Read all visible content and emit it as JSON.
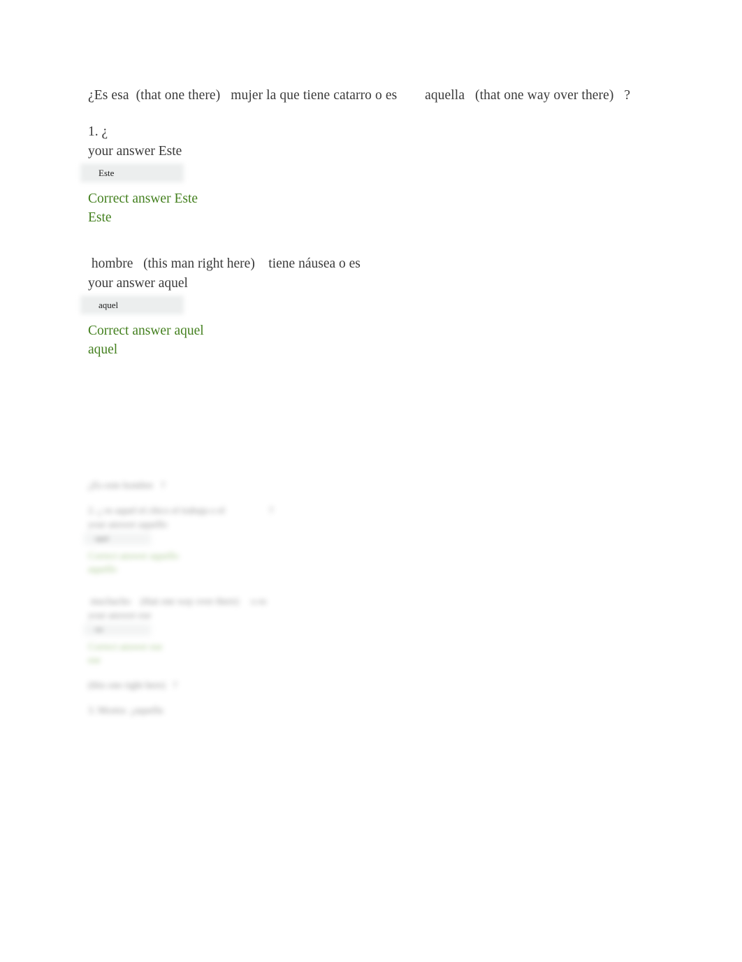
{
  "document": {
    "type": "quiz-answer-review",
    "background_color": "#ffffff",
    "body_text_color": "#3a3a3a",
    "correct_answer_color": "#44801f",
    "answer_box_fill": "#eceeee"
  },
  "upper_section": {
    "header_prompt": "¿Es esa  (that one there)   mujer la que tiene catarro o es        aquella   (that one way over there)   ?",
    "items": [
      {
        "number_prompt": "1. ¿",
        "your_answer_label": "your answer Este",
        "answer_box_value": "Este",
        "correct_answer_label": "Correct answer Este",
        "correct_answer_value": "Este"
      },
      {
        "number_prompt": " hombre   (this man right here)    tiene náusea o es",
        "your_answer_label": "your answer aquel",
        "answer_box_value": "aquel",
        "correct_answer_label": "Correct answer aquel",
        "correct_answer_value": "aquel"
      }
    ]
  },
  "lower_section": {
    "note": "heavily blurred and illegible in the source screenshot",
    "header_prompt": "¿Es este hombre   ?",
    "items": [
      {
        "number_prompt": "2. ¿ es aquel el chico el trabaja o el                  ?",
        "your_answer_label": "your answer aquello",
        "answer_box_value": "aquel",
        "correct_answer_label": "Correct answer aquello",
        "correct_answer_value": "aquello"
      },
      {
        "number_prompt": " muchacho    (that one way over there)     o es",
        "your_answer_label": "your answer ese",
        "answer_box_value": "ese",
        "correct_answer_label": "Correct answer ese",
        "correct_answer_value": "ese"
      }
    ],
    "trailing_lines": [
      "(this one right here)   ?",
      "3. Mostra  ¿aquella"
    ]
  }
}
